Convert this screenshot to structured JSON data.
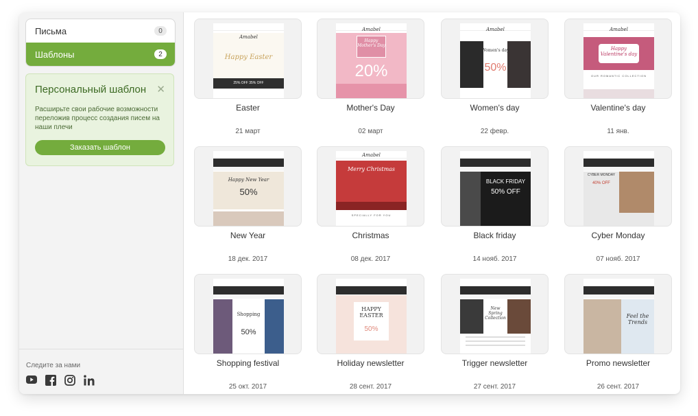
{
  "sidebar": {
    "nav": [
      {
        "label": "Письма",
        "count": "0"
      },
      {
        "label": "Шаблоны",
        "count": "2"
      }
    ],
    "promo": {
      "title": "Персональный шаблон",
      "text": "Расширьте свои рабочие возможности переложив процесс создания писем на наши плечи",
      "button": "Заказать шаблон"
    },
    "follow": {
      "label": "Следите за нами",
      "icons": [
        "youtube-icon",
        "facebook-icon",
        "instagram-icon",
        "linkedin-icon"
      ]
    }
  },
  "templates": [
    {
      "name": "Easter",
      "date": "21 март",
      "preview": {
        "brand": "Amabel",
        "text": "Happy Easter",
        "sub": "25% OFF  35% OFF"
      }
    },
    {
      "name": "Mother's Day",
      "date": "02 март",
      "preview": {
        "brand": "Amabel",
        "text": "Happy Mother's Day",
        "sub": "20%"
      }
    },
    {
      "name": "Women's day",
      "date": "22 февр.",
      "preview": {
        "brand": "Amabel",
        "text": "Women's day",
        "sub": "50%"
      }
    },
    {
      "name": "Valentine's day",
      "date": "11 янв.",
      "preview": {
        "brand": "Amabel",
        "text": "Happy Valentine's day",
        "sub": "OUR ROMANTIC COLLECTION"
      }
    },
    {
      "name": "New Year",
      "date": "18 дек. 2017",
      "preview": {
        "text": "Happy New Year",
        "sub": "50%"
      }
    },
    {
      "name": "Christmas",
      "date": "08 дек. 2017",
      "preview": {
        "brand": "Amabel",
        "text": "Merry Christmas",
        "sub": "SPECIALLY FOR YOU"
      }
    },
    {
      "name": "Black friday",
      "date": "14 нояб. 2017",
      "preview": {
        "text": "BLACK FRIDAY",
        "sub": "50% OFF"
      }
    },
    {
      "name": "Cyber Monday",
      "date": "07 нояб. 2017",
      "preview": {
        "text": "CYBER MONDAY",
        "sub": "40% OFF"
      }
    },
    {
      "name": "Shopping festival",
      "date": "25 окт. 2017",
      "preview": {
        "text": "Shopping",
        "sub": "50%"
      }
    },
    {
      "name": "Holiday newsletter",
      "date": "28 сент. 2017",
      "preview": {
        "text": "HAPPY EASTER",
        "sub": "50%"
      }
    },
    {
      "name": "Trigger newsletter",
      "date": "27 сент. 2017",
      "preview": {
        "text": "New Spring Collection",
        "sub": ""
      }
    },
    {
      "name": "Promo newsletter",
      "date": "26 сент. 2017",
      "preview": {
        "text": "Feel the Trends",
        "sub": ""
      }
    }
  ],
  "colors": {
    "accent": "#74ac3d",
    "promo_bg": "#e9f3df",
    "promo_text": "#3c6a23"
  }
}
